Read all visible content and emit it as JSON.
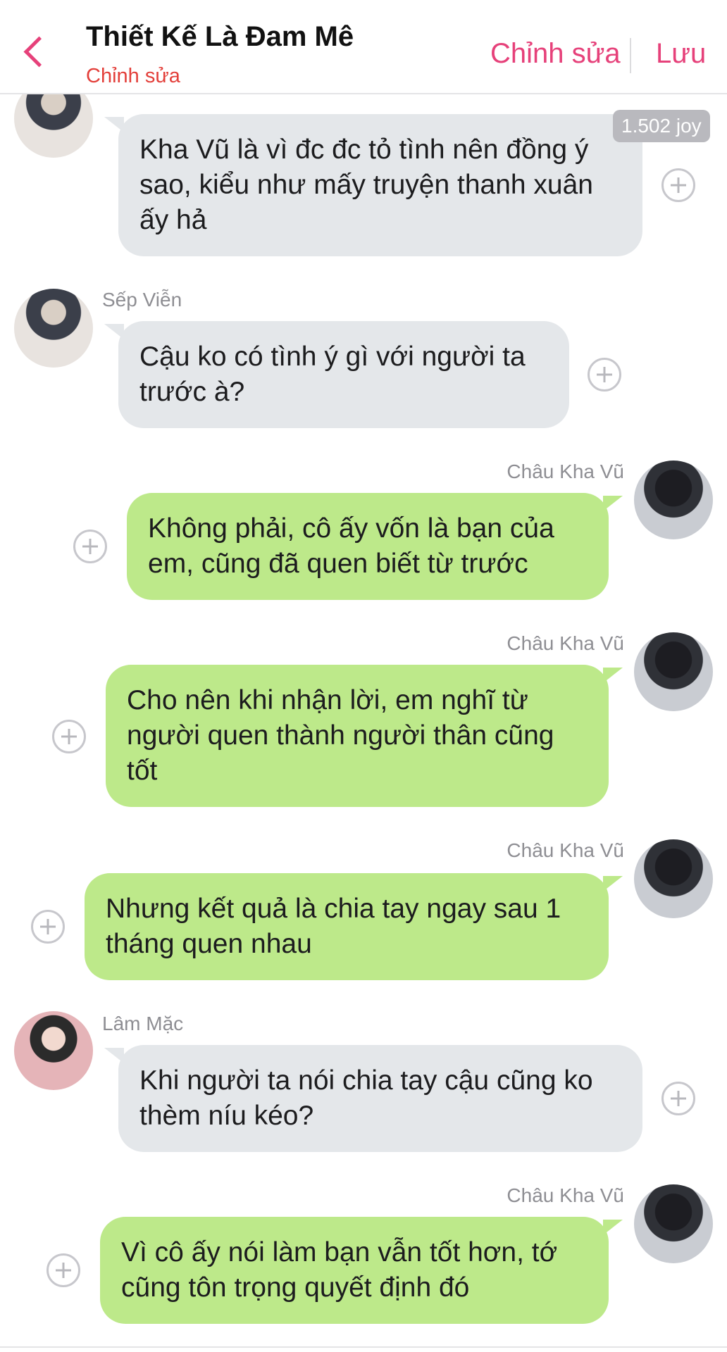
{
  "header": {
    "title": "Thiết Kế Là Đam Mê",
    "subtitle": "Chỉnh sửa",
    "edit_label": "Chỉnh sửa",
    "save_label": "Lưu"
  },
  "joy_badge": "1.502 joy",
  "messages": [
    {
      "sender": "Sếp Viễn",
      "side": "left",
      "text": "Kha Vũ là vì đc đc tỏ tình nên đồng ý sao, kiểu như mấy truyện thanh xuân ấy hả"
    },
    {
      "sender": "Sếp Viễn",
      "side": "left",
      "text": "Cậu ko có tình ý gì với người ta trước à?"
    },
    {
      "sender": "Châu Kha Vũ",
      "side": "right",
      "text": "Không phải, cô ấy vốn là bạn của em, cũng đã quen biết từ trước"
    },
    {
      "sender": "Châu Kha Vũ",
      "side": "right",
      "text": "Cho nên khi nhận lời, em nghĩ từ người quen thành người thân cũng tốt"
    },
    {
      "sender": "Châu Kha Vũ",
      "side": "right",
      "text": "Nhưng kết quả là chia tay ngay sau 1 tháng quen nhau"
    },
    {
      "sender": "Lâm Mặc",
      "side": "left",
      "text": "Khi người ta nói chia tay cậu cũng ko thèm níu kéo?"
    },
    {
      "sender": "Châu Kha Vũ",
      "side": "right",
      "text": "Vì cô ấy nói làm bạn vẫn tốt hơn, tớ cũng tôn trọng quyết định đó"
    }
  ],
  "colors": {
    "accent": "#e6417a",
    "subtitle": "#e33f3a",
    "bubble_left": "#e4e7ea",
    "bubble_right": "#bde98a"
  },
  "icons": [
    "back-chevron-icon",
    "add-reaction-icon"
  ]
}
